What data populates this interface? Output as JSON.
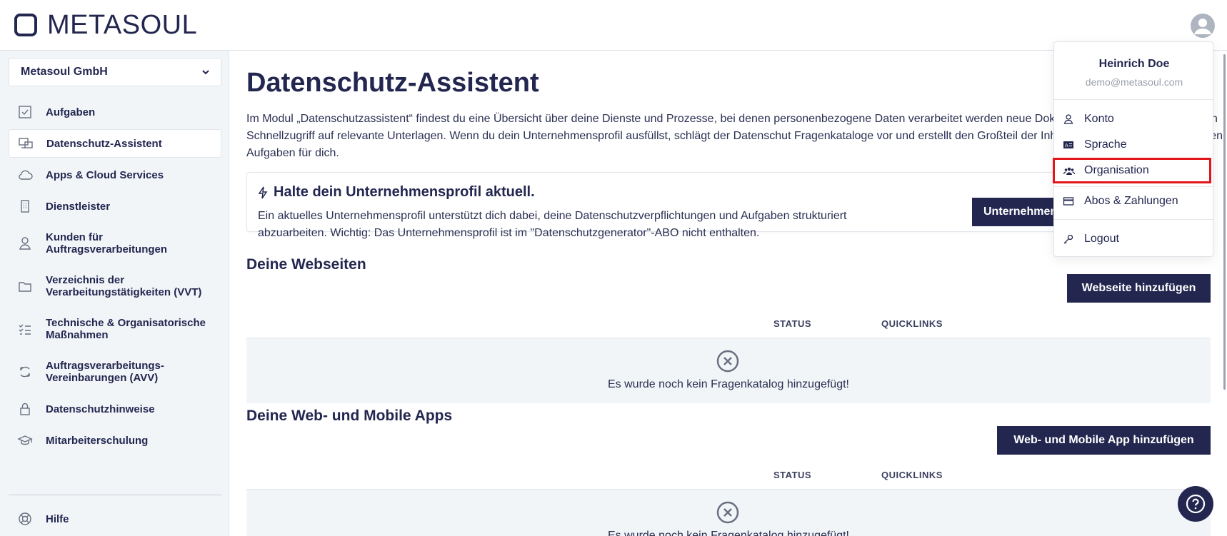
{
  "header": {
    "logo_text": "METASOUL"
  },
  "sidebar": {
    "org_name": "Metasoul GmbH",
    "items": [
      {
        "label": "Aufgaben",
        "icon": "checkbox-icon"
      },
      {
        "label": "Datenschutz-Assistent",
        "icon": "assistant-icon"
      },
      {
        "label": "Apps & Cloud Services",
        "icon": "cloud-icon"
      },
      {
        "label": "Dienstleister",
        "icon": "building-icon"
      },
      {
        "label": "Kunden für Auftragsverarbeitungen",
        "icon": "person-icon"
      },
      {
        "label": "Verzeichnis der Verarbeitungstätigkeiten (VVT)",
        "icon": "folder-icon"
      },
      {
        "label": "Technische & Organisatorische Maßnahmen",
        "icon": "list-check-icon"
      },
      {
        "label": "Auftragsverarbeitungs-Vereinbarungen (AVV)",
        "icon": "sync-icon"
      },
      {
        "label": "Datenschutzhinweise",
        "icon": "lock-icon"
      },
      {
        "label": "Mitarbeiterschulung",
        "icon": "graduation-cap-icon"
      }
    ],
    "help_label": "Hilfe"
  },
  "main": {
    "title": "Datenschutz-Assistent",
    "intro": "Im Modul „Datenschutzassistent“ findest du eine Übersicht über deine Dienste und Prozesse, bei denen personenbezogene Daten verarbeitet werden neue Dokumente erstellen und hast einen Schnellzugriff auf relevante Unterlagen. Wenn du dein Unternehmensprofil ausfüllst, schlägt der Datenschut Fragenkataloge vor und erstellt den Großteil der Inhalte und die zugehörigen offenen Aufgaben für dich.",
    "profile_card": {
      "title": "Halte dein Unternehmensprofil aktuell.",
      "text": "Ein aktuelles Unternehmensprofil unterstützt dich dabei, deine Datenschutzverpflichtungen und Aufgaben strukturiert abzuarbeiten. Wichtig: Das Unternehmensprofil ist im \"Datenschutzgenerator\"-ABO nicht enthalten.",
      "button": "Unternehmensprofil"
    },
    "sections": [
      {
        "title": "Deine Webseiten",
        "button": "Webseite hinzufügen",
        "col_status": "STATUS",
        "col_quicklinks": "QUICKLINKS",
        "empty_text": "Es wurde noch kein Fragenkatalog hinzugefügt!"
      },
      {
        "title": "Deine Web- und Mobile Apps",
        "button": "Web- und Mobile App hinzufügen",
        "col_status": "STATUS",
        "col_quicklinks": "QUICKLINKS",
        "empty_text": "Es wurde noch kein Fragenkatalog hinzugefügt!"
      }
    ]
  },
  "user_menu": {
    "name": "Heinrich Doe",
    "email": "demo@metasoul.com",
    "items": [
      {
        "label": "Konto",
        "icon": "user-icon"
      },
      {
        "label": "Sprache",
        "icon": "language-icon"
      },
      {
        "label": "Organisation",
        "icon": "users-icon",
        "highlighted": true
      },
      {
        "label": "Abos & Zahlungen",
        "icon": "credit-card-icon"
      },
      {
        "label": "Logout",
        "icon": "key-icon"
      }
    ]
  },
  "colors": {
    "primary": "#232750",
    "sidebar_bg": "#f2f5f8",
    "highlight_border": "#e3151a"
  }
}
